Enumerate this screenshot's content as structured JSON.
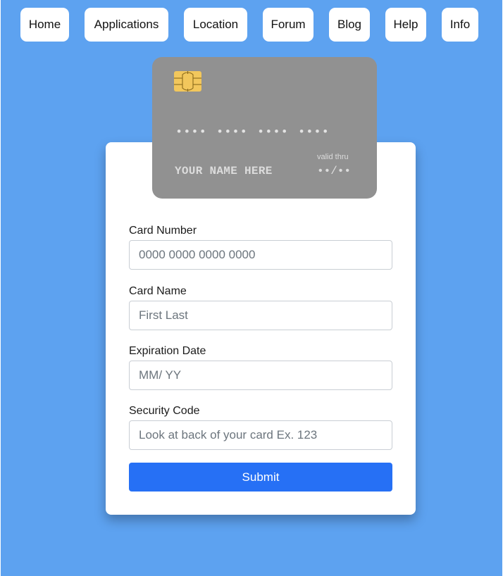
{
  "nav": {
    "items": [
      {
        "label": "Home"
      },
      {
        "label": "Applications"
      },
      {
        "label": "Location"
      },
      {
        "label": "Forum"
      },
      {
        "label": "Blog"
      },
      {
        "label": "Help"
      },
      {
        "label": "Info"
      }
    ]
  },
  "card_preview": {
    "number": "•••• •••• •••• ••••",
    "name": "YOUR NAME HERE",
    "valid_thru_label": "valid thru",
    "expiry": "••/••",
    "chip_icon": "sim-chip-icon",
    "colors": {
      "card": "#919191",
      "chip": "#f2c75c"
    }
  },
  "form": {
    "card_number": {
      "label": "Card Number",
      "placeholder": "0000 0000 0000 0000",
      "value": ""
    },
    "card_name": {
      "label": "Card Name",
      "placeholder": "First Last",
      "value": ""
    },
    "expiration": {
      "label": "Expiration Date",
      "placeholder": "MM/ YY",
      "value": ""
    },
    "security_code": {
      "label": "Security Code",
      "placeholder": "Look at back of your card Ex. 123",
      "value": ""
    },
    "submit_label": "Submit"
  },
  "colors": {
    "background": "#5da2f0",
    "accent": "#2670f5"
  }
}
